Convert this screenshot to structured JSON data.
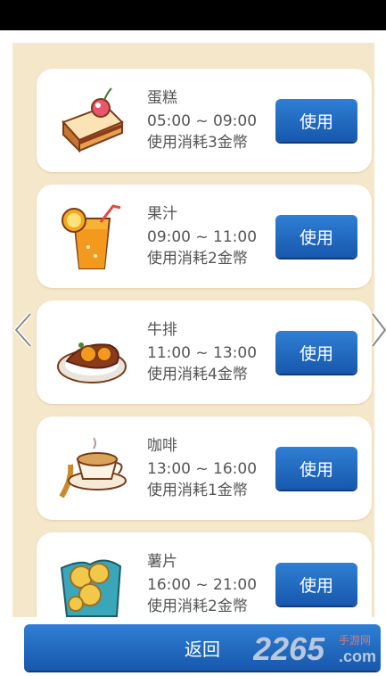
{
  "items": [
    {
      "name": "蛋糕",
      "time": "05:00 ~ 09:00",
      "cost": "使用消耗3金幣",
      "button": "使用",
      "icon": "cake-icon"
    },
    {
      "name": "果汁",
      "time": "09:00 ~ 11:00",
      "cost": "使用消耗2金幣",
      "button": "使用",
      "icon": "juice-icon"
    },
    {
      "name": "牛排",
      "time": "11:00 ~ 13:00",
      "cost": "使用消耗4金幣",
      "button": "使用",
      "icon": "steak-icon"
    },
    {
      "name": "咖啡",
      "time": "13:00 ~ 16:00",
      "cost": "使用消耗1金幣",
      "button": "使用",
      "icon": "coffee-icon"
    },
    {
      "name": "薯片",
      "time": "16:00 ~ 21:00",
      "cost": "使用消耗2金幣",
      "button": "使用",
      "icon": "chips-icon"
    }
  ],
  "nav": {
    "prev_icon": "chevron-left-icon",
    "next_icon": "chevron-right-icon"
  },
  "footer": {
    "return_label": "返回"
  },
  "watermark": {
    "number": "2265",
    "domain": ".com",
    "tagline": "手游网"
  },
  "colors": {
    "panel": "#f5e7c9",
    "button": "#1f68c1",
    "card": "#ffffff"
  }
}
